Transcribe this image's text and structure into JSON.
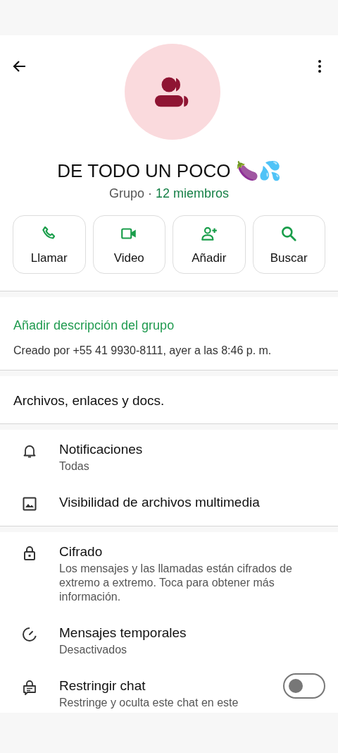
{
  "group": {
    "name": "DE TODO UN POCO 🍆💦",
    "type_label": "Grupo",
    "separator": "·",
    "members": "12 miembros"
  },
  "actions": [
    {
      "kind": "call",
      "label": "Llamar"
    },
    {
      "kind": "video",
      "label": "Video"
    },
    {
      "kind": "add",
      "label": "Añadir"
    },
    {
      "kind": "search",
      "label": "Buscar"
    }
  ],
  "description": {
    "link": "Añadir descripción del grupo",
    "created": "Creado por +55 41 9930-8111, ayer a las 8:46 p. m."
  },
  "media_link": "Archivos, enlaces y docs.",
  "settings_sections": [
    [
      {
        "kind": "bell",
        "title": "Notificaciones",
        "subtitle": "Todas"
      },
      {
        "kind": "image",
        "title": "Visibilidad de archivos multimedia"
      }
    ],
    [
      {
        "kind": "lock",
        "title": "Cifrado",
        "subtitle": "Los mensajes y las llamadas están cifrados de extremo a extremo. Toca para obtener más información."
      },
      {
        "kind": "timer",
        "title": "Mensajes temporales",
        "subtitle": "Desactivados"
      },
      {
        "kind": "chatlock",
        "title": "Restringir chat",
        "subtitle": "Restringe y oculta este chat en este",
        "toggle": {
          "on": false
        }
      }
    ]
  ]
}
